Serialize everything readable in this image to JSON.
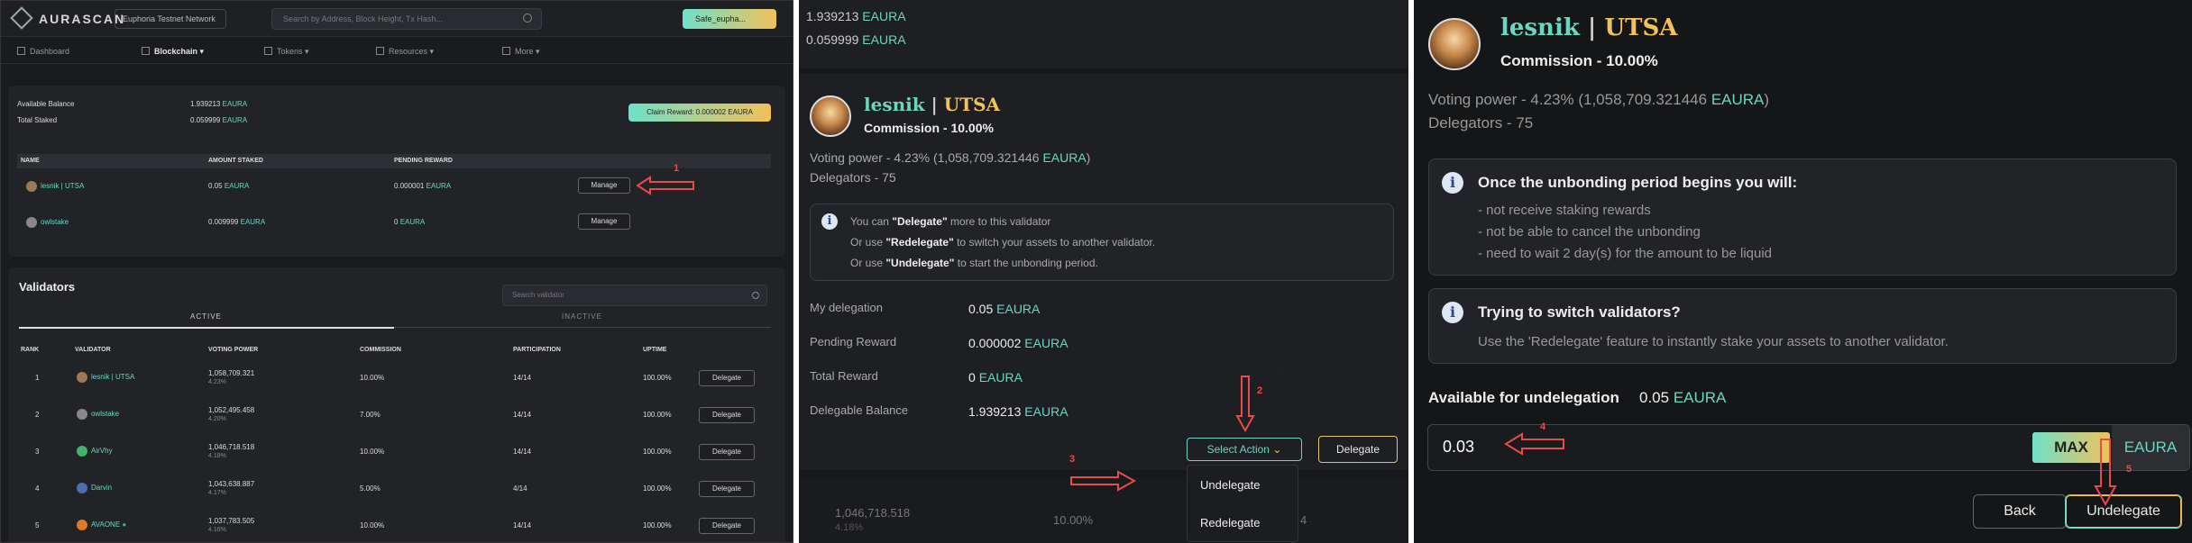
{
  "panel1": {
    "logo": "AURASCAN",
    "network": "Euphoria Testnet Network",
    "search_placeholder": "Search by Address, Block Height, Tx Hash...",
    "wallet": "Safe_eupha...",
    "nav": [
      "Dashboard",
      "Blockchain",
      "Tokens",
      "Resources",
      "More"
    ],
    "available_balance_label": "Available Balance",
    "available_balance": "1.939213",
    "total_staked_label": "Total Staked",
    "total_staked": "0.059999",
    "unit": "EAURA",
    "claim_reward": "Claim Reward: 0.000002 EAURA",
    "delegations_headers": [
      "NAME",
      "AMOUNT STAKED",
      "PENDING REWARD"
    ],
    "delegations": [
      {
        "name": "lesnik | UTSA",
        "amount": "0.05",
        "reward": "0.000001",
        "action": "Manage"
      },
      {
        "name": "owlstake",
        "amount": "0.009999",
        "reward": "0",
        "action": "Manage"
      }
    ],
    "validators_title": "Validators",
    "search_validator": "Search validator",
    "tabs": [
      "ACTIVE",
      "INACTIVE"
    ],
    "validators_headers": [
      "RANK",
      "VALIDATOR",
      "VOTING POWER",
      "COMMISSION",
      "PARTICIPATION",
      "UPTIME"
    ],
    "validators": [
      {
        "rank": "1",
        "name": "lesnik | UTSA",
        "power": "1,058,709.321",
        "pct": "4.23%",
        "commission": "10.00%",
        "participation": "14/14",
        "uptime": "100.00%",
        "action": "Delegate"
      },
      {
        "rank": "2",
        "name": "owlstake",
        "power": "1,052,495.458",
        "pct": "4.20%",
        "commission": "7.00%",
        "participation": "14/14",
        "uptime": "100.00%",
        "action": "Delegate"
      },
      {
        "rank": "3",
        "name": "AirVhy",
        "power": "1,046,718.518",
        "pct": "4.18%",
        "commission": "10.00%",
        "participation": "14/14",
        "uptime": "100.00%",
        "action": "Delegate"
      },
      {
        "rank": "4",
        "name": "Darvin",
        "power": "1,043,638.887",
        "pct": "4.17%",
        "commission": "5.00%",
        "participation": "4/14",
        "uptime": "100.00%",
        "action": "Delegate"
      },
      {
        "rank": "5",
        "name": "AVAONE",
        "power": "1,037,783.505",
        "pct": "4.16%",
        "commission": "10.00%",
        "participation": "14/14",
        "uptime": "100.00%",
        "action": "Delegate"
      }
    ],
    "annotation": "1"
  },
  "panel2": {
    "top_balance1": "1.939213",
    "top_balance2": "0.059999",
    "unit": "EAURA",
    "validator_first": "lesnik",
    "validator_sep": " | ",
    "validator_second": "UTSA",
    "commission": "Commission - 10.00%",
    "voting_power_prefix": "Voting power - 4.23%",
    "voting_power_amount": "(1,058,709.321446",
    "voting_power_close": ")",
    "delegators": "Delegators - 75",
    "info_line1_a": "You can ",
    "info_line1_b": "\"Delegate\"",
    "info_line1_c": " more to this validator",
    "info_line2_a": "Or use ",
    "info_line2_b": "\"Redelegate\"",
    "info_line2_c": " to switch your assets to another validator.",
    "info_line3_a": "Or use ",
    "info_line3_b": "\"Undelegate\"",
    "info_line3_c": " to start the unbonding period.",
    "my_delegation_label": "My delegation",
    "my_delegation": "0.05",
    "pending_reward_label": "Pending Reward",
    "pending_reward": "0.000002",
    "total_reward_label": "Total Reward",
    "total_reward": "0",
    "delegable_label": "Delegable Balance",
    "delegable": "1.939213",
    "select_action": "Select Action",
    "delegate_btn": "Delegate",
    "menu_undelegate": "Undelegate",
    "menu_redelegate": "Redelegate",
    "bottom_power": "1,046,718.518",
    "bottom_pct": "4.18%",
    "bottom_commission": "10.00%",
    "bottom_part": "4",
    "annotation2": "2",
    "annotation3": "3"
  },
  "panel3": {
    "validator_first": "lesnik",
    "validator_sep": " | ",
    "validator_second": "UTSA",
    "commission": "Commission - 10.00%",
    "voting_power_prefix": "Voting power - 4.23%",
    "voting_power_amount": "(1,058,709.321446",
    "voting_power_close": ")",
    "unit": "EAURA",
    "delegators": "Delegators - 75",
    "unbond_title": "Once the unbonding period begins you will:",
    "unbond_items": [
      "- not receive staking rewards",
      "- not be able to cancel the unbonding",
      "- need to wait 2 day(s) for the amount to be liquid"
    ],
    "switch_title": "Trying to switch validators?",
    "switch_text": "Use the 'Redelegate' feature to instantly stake your assets to another validator.",
    "available_label": "Available for undelegation",
    "available_value": "0.05",
    "input_value": "0.03",
    "max": "MAX",
    "back": "Back",
    "undelegate": "Undelegate",
    "annotation4": "4",
    "annotation5": "5"
  },
  "colors": {
    "accent": "#69d7bf",
    "gold": "#f2c15a",
    "annotation": "#e94a4a"
  }
}
